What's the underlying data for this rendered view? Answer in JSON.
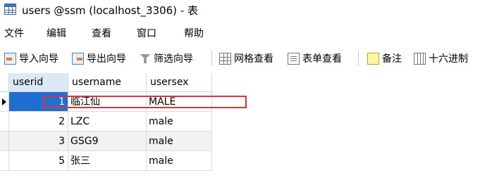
{
  "window": {
    "title": "users @ssm (localhost_3306) - 表"
  },
  "menu": [
    "文件",
    "编辑",
    "查看",
    "窗口",
    "帮助"
  ],
  "toolbar": {
    "import": "导入向导",
    "export": "导出向导",
    "filter": "筛选向导",
    "grid_view": "网格查看",
    "form_view": "表单查看",
    "memo": "备注",
    "hex": "十六进制"
  },
  "table": {
    "columns": [
      "userid",
      "username",
      "usersex"
    ],
    "rows": [
      {
        "userid": "1",
        "username": "临江仙",
        "usersex": "MALE"
      },
      {
        "userid": "2",
        "username": "LZC",
        "usersex": "male"
      },
      {
        "userid": "3",
        "username": "GSG9",
        "usersex": "male"
      },
      {
        "userid": "5",
        "username": "张三",
        "usersex": "male"
      }
    ]
  },
  "colors": {
    "selected_cell": "#1f6fd2",
    "header_active": "#dbe8f6",
    "alt_row": "#f2f2f2",
    "annotation_box": "#e0323a"
  }
}
